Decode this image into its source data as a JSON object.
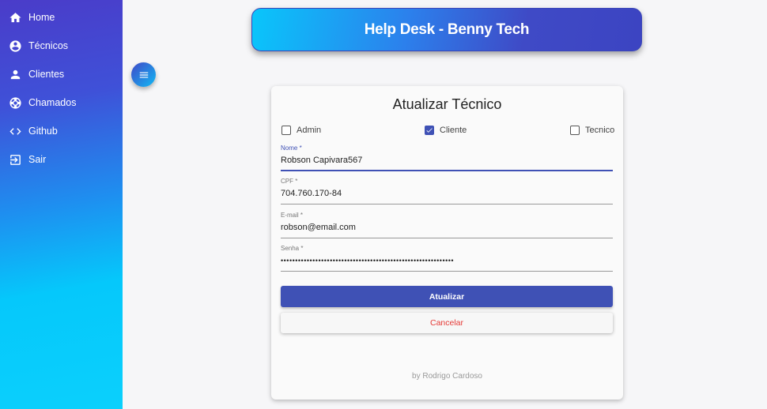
{
  "sidebar": {
    "items": [
      {
        "label": "Home",
        "icon": "home-icon"
      },
      {
        "label": "Técnicos",
        "icon": "account-circle-icon"
      },
      {
        "label": "Clientes",
        "icon": "person-icon"
      },
      {
        "label": "Chamados",
        "icon": "support-icon"
      },
      {
        "label": "Github",
        "icon": "code-icon"
      },
      {
        "label": "Sair",
        "icon": "logout-icon"
      }
    ]
  },
  "header": {
    "title": "Help Desk - Benny Tech"
  },
  "form": {
    "title": "Atualizar Técnico",
    "profiles": [
      {
        "label": "Admin",
        "checked": false
      },
      {
        "label": "Cliente",
        "checked": true
      },
      {
        "label": "Tecnico",
        "checked": false
      }
    ],
    "fields": {
      "nome": {
        "label": "Nome *",
        "value": "Robson Capivara567"
      },
      "cpf": {
        "label": "CPF *",
        "value": "704.760.170-84"
      },
      "email": {
        "label": "E-mail *",
        "value": "robson@email.com"
      },
      "senha": {
        "label": "Senha *",
        "value": "••••••••••••••••••••••••••••••••••••••••••••••••••••••••••••"
      }
    },
    "submit_label": "Atualizar",
    "cancel_label": "Cancelar",
    "footer": "by Rodrigo Cardoso"
  },
  "colors": {
    "primary": "#3f51b5",
    "cancel": "#e53935",
    "accent_cyan": "#05c8fb"
  }
}
